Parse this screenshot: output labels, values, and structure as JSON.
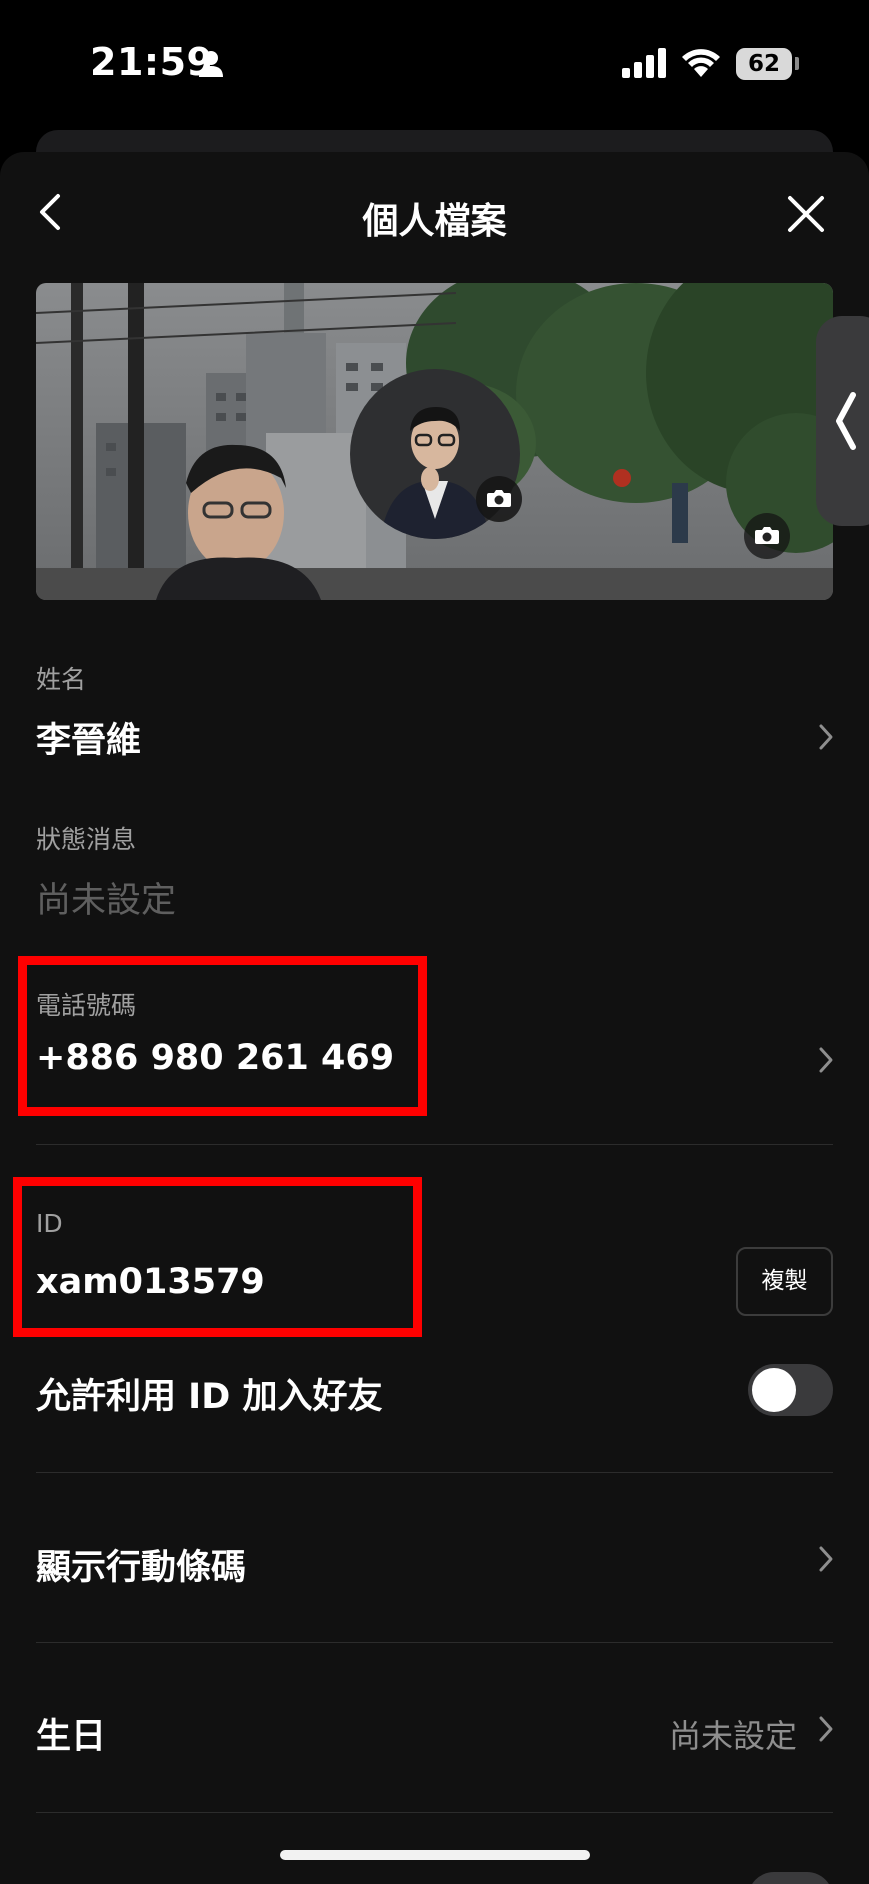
{
  "status_bar": {
    "time": "21:59",
    "battery": "62"
  },
  "nav": {
    "title": "個人檔案"
  },
  "profile": {
    "name_label": "姓名",
    "name_value": "李晉維",
    "status_label": "狀態消息",
    "status_placeholder": "尚未設定",
    "phone_label": "電話號碼",
    "phone_value": "+886 980 261 469",
    "id_label": "ID",
    "id_value": "xam013579",
    "copy_button": "複製",
    "allow_id_label": "允許利用 ID 加入好友",
    "allow_id_enabled": false,
    "barcode_label": "顯示行動條碼",
    "birthday_label": "生日",
    "birthday_value": "尚未設定"
  },
  "icons": {
    "back": "chevron-left-icon",
    "close": "close-icon",
    "camera": "camera-icon",
    "chevron_right": "chevron-right-icon"
  },
  "colors": {
    "background": "#111111",
    "highlight": "#ff0000",
    "muted_text": "#a0a0a0"
  }
}
